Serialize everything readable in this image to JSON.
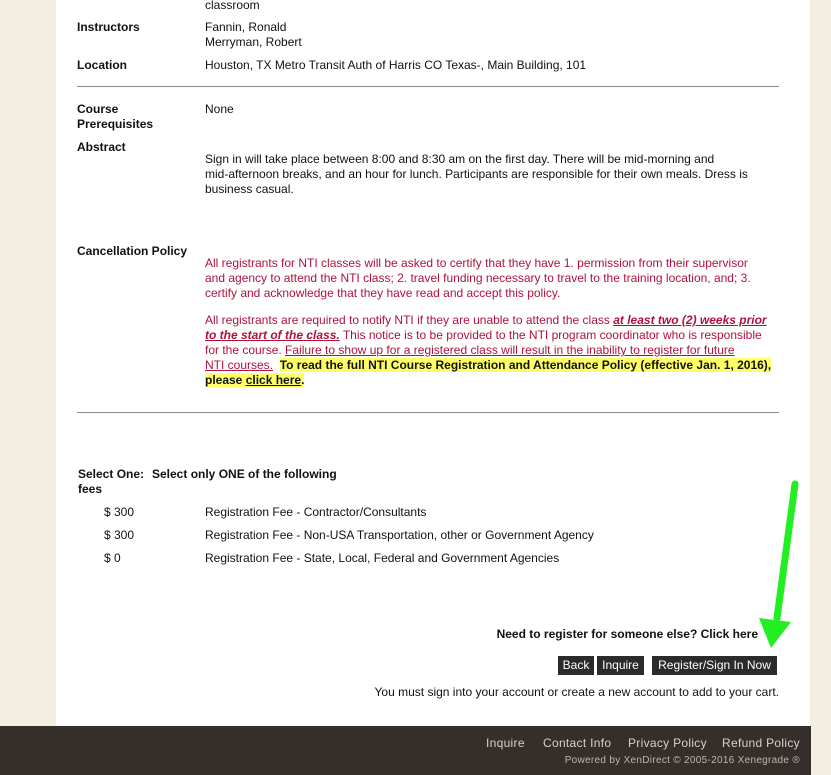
{
  "course": {
    "top_text": "classroom",
    "instructors_label": "Instructors",
    "instructors": [
      "Fannin, Ronald",
      "Merryman, Robert"
    ],
    "location_label": "Location",
    "location": "Houston, TX Metro Transit Auth of Harris CO Texas-, Main Building, 101",
    "prereq_label_1": "Course",
    "prereq_label_2": "Prerequisites",
    "prereq_value": "None",
    "abstract_label": "Abstract",
    "abstract_lines": [
      "Sign in will take place between 8:00 and 8:30 am on the first day. There will be mid-morning and",
      "mid-afternoon breaks, and an hour for lunch. Participants are responsible for their own meals. Dress is",
      "business casual."
    ]
  },
  "cancellation": {
    "label": "Cancellation Policy",
    "para1_lines": [
      "All registrants for NTI classes will be asked to certify that they have 1. permission from their supervisor",
      "and agency to attend the NTI class; 2.  travel funding necessary to travel to the training location, and; 3.",
      "certify and acknowledge that they have read and accept this policy."
    ],
    "p2_a": "All registrants are required to notify NTI if they are unable to attend the class ",
    "p2_b": "at least two (2) weeks prior",
    "p2_c": "to the start of the class.",
    "p2_d": "  This notice is to be provided to the NTI program coordinator who is responsible",
    "p2_e": "for the course. ",
    "p2_f": "Failure to show up for a registered class will result in the inability to register for future",
    "p2_g": "NTI courses.",
    "p2_h": "To read the full NTI Course Registration and Attendance Policy (effective Jan. 1, 2016),",
    "p2_i": "please ",
    "p2_link": "click here",
    "p2_end": "."
  },
  "fees": {
    "select_label": "Select One:",
    "select_label_2": "fees",
    "instruction": "Select only ONE of the following",
    "items": [
      {
        "price": "$ 300",
        "name": "Registration Fee - Contractor/Consultants"
      },
      {
        "price": "$ 300",
        "name": "Registration Fee - Non-USA Transportation, other or Government Agency"
      },
      {
        "price": "$ 0",
        "name": "Registration Fee - State, Local, Federal and Government Agencies"
      }
    ]
  },
  "actions": {
    "register_other": "Need to register for someone else? Click here",
    "back": "Back",
    "inquire": "Inquire",
    "register": "Register/Sign In Now",
    "signin_note": "You must sign into your account or create a new account to add to your cart."
  },
  "footer": {
    "links": [
      "Inquire",
      "Contact Info",
      "Privacy Policy",
      "Refund Policy"
    ],
    "powered": "Powered by XenDirect © 2005-2016 Xenegrade ®"
  },
  "colors": {
    "policy_text": "#b0123c",
    "highlight": "#ffff66",
    "annotation_arrow": "#22ee22",
    "footer_bg": "#342f2a"
  }
}
